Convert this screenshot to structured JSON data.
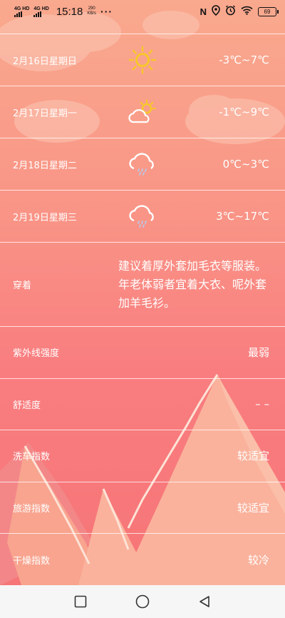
{
  "status_bar": {
    "sim1": "4G HD",
    "sim2": "4G HD",
    "time": "15:18",
    "net_speed_value": "290",
    "net_speed_unit": "KB/s",
    "more": "···",
    "battery": "69"
  },
  "forecast": [
    {
      "date": "2月16日星期日",
      "icon": "sun-icon",
      "temp": "-3℃~7℃"
    },
    {
      "date": "2月17日星期一",
      "icon": "partly-cloudy-icon",
      "temp": "-1℃~9℃"
    },
    {
      "date": "2月18日星期二",
      "icon": "cloud-rain-icon",
      "temp": "0℃~3℃"
    },
    {
      "date": "2月19日星期三",
      "icon": "cloud-rain-icon",
      "temp": "3℃~17℃"
    }
  ],
  "dress": {
    "label": "穿着",
    "advice": "建议着厚外套加毛衣等服装。年老体弱者宜着大衣、呢外套加羊毛衫。"
  },
  "indices": [
    {
      "label": "紫外线强度",
      "value": "最弱"
    },
    {
      "label": "舒适度",
      "value": "– –"
    },
    {
      "label": "洗车指数",
      "value": "较适宜"
    },
    {
      "label": "旅游指数",
      "value": "较适宜"
    },
    {
      "label": "干燥指数",
      "value": "较冷"
    }
  ],
  "colors": {
    "gradient_top": "#f9a98e",
    "gradient_bottom": "#f67476",
    "sun": "#f7c72a",
    "mountain": "#fbb09a"
  },
  "nav": [
    "square-recent-icon",
    "circle-home-icon",
    "triangle-back-icon"
  ]
}
